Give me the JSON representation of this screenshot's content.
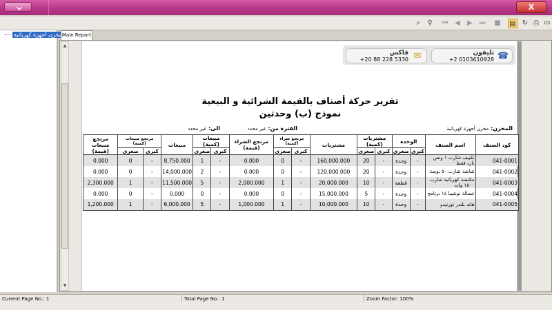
{
  "window": {
    "close_glyph": "X"
  },
  "toolbar": {
    "icons": [
      "find-icon",
      "binoculars-icon",
      "first-page-icon",
      "prev-page-icon",
      "next-page-icon",
      "last-page-icon",
      "page-setup-icon",
      "refresh-icon",
      "print-icon",
      "export-icon"
    ]
  },
  "tree": {
    "root_label": "مخزن أجهزة كهربائية"
  },
  "tabs": [
    {
      "label": "Main Report"
    }
  ],
  "report": {
    "contact": {
      "phone_label": "تليفون",
      "phone_value": "+2 0103610928",
      "fax_label": "فاكس",
      "fax_value": "+20 88 228 5330"
    },
    "title": "تقرير حركة أصناف بالقيمة الشرائية و البيعية",
    "subtitle": "نموذج (ب) وحدتين",
    "store_label": "المخزن:",
    "store_value": "مخزن أجهزة كهربائية",
    "period_from_label": "الفترة من:",
    "period_from_value": "غير محدد",
    "period_to_label": "الى:",
    "period_to_value": "غير محدد",
    "headers": {
      "code": "كود الصنف",
      "name": "اسم الصنف",
      "unit": "الوحدة",
      "purch_qty": "مشتريات (كمية)",
      "purchases": "مشتريات",
      "purch_ret_qty": "مرتجع شراء (كمية)",
      "purch_ret_value": "مرتجع الشراء (قيمة)",
      "sales_qty": "مبيعات (كمية)",
      "sales": "مبيعات",
      "sales_ret_qty": "مرتجع مبيعات (كمية)",
      "sales_ret_value": "مرتجع مبيعات (قيمة)",
      "big": "كبرى",
      "small": "صغرى"
    },
    "rows": [
      {
        "code": "041-0001",
        "name": "تكييف شارب ١ ونص بارد فقط",
        "unit_big": "-",
        "unit_small": "وحدة",
        "pq_big": "-",
        "pq_small": "20",
        "purchases": "160,000.000",
        "prq_big": "-",
        "prq_small": "0",
        "pr_value": "0.000",
        "sq_big": "-",
        "sq_small": "1",
        "sales": "8,750.000",
        "srq_big": "-",
        "srq_small": "0",
        "sr_value": "0.000"
      },
      {
        "code": "041-0002",
        "name": "شاشة شارب ٥٠ بوصة",
        "unit_big": "-",
        "unit_small": "وحدة",
        "pq_big": "-",
        "pq_small": "20",
        "purchases": "120,000.000",
        "prq_big": "-",
        "prq_small": "0",
        "pr_value": "0.000",
        "sq_big": "-",
        "sq_small": "2",
        "sales": "14,000.000",
        "srq_big": "-",
        "srq_small": "0",
        "sr_value": "0.000"
      },
      {
        "code": "041-0003",
        "name": "مكنسة كهربائية شارب ١٥٠٠ وات",
        "unit_big": "-",
        "unit_small": "قطعة",
        "pq_big": "-",
        "pq_small": "10",
        "purchases": "20,000.000",
        "prq_big": "-",
        "prq_small": "1",
        "pr_value": "2,000.000",
        "sq_big": "-",
        "sq_small": "5",
        "sales": "11,500.000",
        "srq_big": "-",
        "srq_small": "1",
        "sr_value": "2,300.000"
      },
      {
        "code": "041-0004",
        "name": "غسالة توشيبا ١٤ برنامج",
        "unit_big": "-",
        "unit_small": "وحدة",
        "pq_big": "-",
        "pq_small": "5",
        "purchases": "15,000.000",
        "prq_big": "-",
        "prq_small": "0",
        "pr_value": "0.000",
        "sq_big": "-",
        "sq_small": "0",
        "sales": "0.000",
        "srq_big": "-",
        "srq_small": "0",
        "sr_value": "0.000"
      },
      {
        "code": "041-0005",
        "name": "هاند بلندر تورنيدو",
        "unit_big": "-",
        "unit_small": "وحدة",
        "pq_big": "-",
        "pq_small": "10",
        "purchases": "10,000.000",
        "prq_big": "-",
        "prq_small": "1",
        "pr_value": "1,000.000",
        "sq_big": "-",
        "sq_small": "5",
        "sales": "6,000.000",
        "srq_big": "-",
        "srq_small": "1",
        "sr_value": "1,200.000"
      }
    ]
  },
  "status": {
    "current_page": "Current Page No.: 1",
    "total_page": "Total Page No.: 1",
    "zoom": "Zoom Factor: 100%"
  }
}
